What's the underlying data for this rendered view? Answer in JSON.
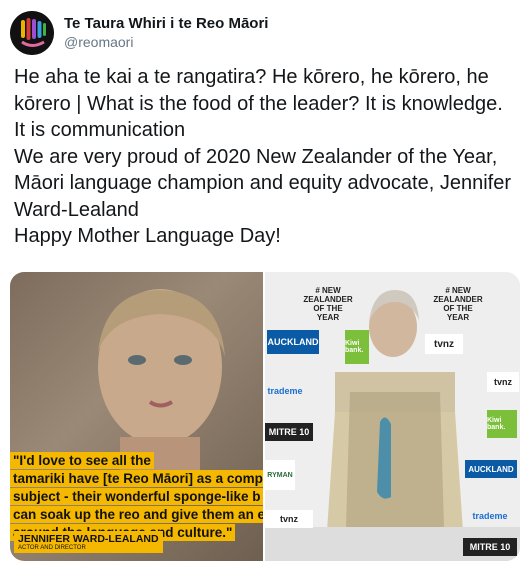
{
  "account": {
    "display_name": "Te Taura Whiri i te Reo Māori",
    "handle": "@reomaori"
  },
  "tweet": {
    "lines": [
      "He aha te kai a te rangatira? He kōrero, he kōrero, he kōrero | What is the food of the leader? It is knowledge. It is communication",
      "We are very proud of 2020 New Zealander of the Year, Māori language champion and equity advocate, Jennifer Ward-Lealand",
      "Happy Mother Language Day!"
    ]
  },
  "media": {
    "left_image": {
      "quote_lines": [
        "\"I'd love to see all the",
        "tamariki have [te Reo Māori] as a comp",
        "subject - their wonderful sponge-like b",
        "can soak up the reo and give them an e",
        "around the language and culture.\""
      ],
      "attribution_name": "JENNIFER WARD-LEALAND",
      "attribution_role": "ACTOR AND DIRECTOR",
      "accent_color": "#f5b800"
    },
    "right_image": {
      "logos": {
        "nz_of_year": "NEW ZEALANDER OF THE YEAR",
        "auckland": "AUCKLAND",
        "kiwibank": "Kiwi bank.",
        "tvnz": "tvnz",
        "trademe": "trademe",
        "mitre10": "MITRE 10",
        "ryman": "RYMAN"
      }
    }
  }
}
